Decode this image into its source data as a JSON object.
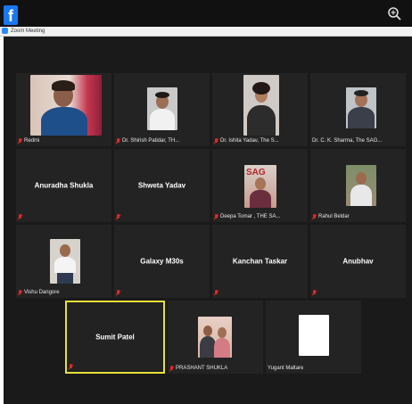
{
  "app": {
    "window_title": "Zoom Meeting"
  },
  "colors": {
    "stage_bg": "#1a1a1a",
    "tile_bg": "#232323",
    "active_border": "#e6df3b",
    "muted_icon": "#e02828",
    "facebook_blue": "#1877f2"
  },
  "icons": {
    "facebook": "facebook-icon",
    "zoom": "zoom-in-icon",
    "muted": "muted-mic-icon"
  },
  "participants": {
    "p1": {
      "name": "Redmi",
      "muted": true
    },
    "p2": {
      "name": "Dr. Shirish Patidar, TH...",
      "muted": true
    },
    "p3": {
      "name": "Dr. Ishita Yadav, The S...",
      "muted": true
    },
    "p4": {
      "name": "Dr. C. K. Sharma, The SAG...",
      "muted": false
    },
    "p5": {
      "name": "Anuradha Shukla",
      "muted": true
    },
    "p6": {
      "name": "Shweta  Yadav",
      "muted": true
    },
    "p7": {
      "name": "Deepa Tomar , THE SA...",
      "muted": true
    },
    "p8": {
      "name": "Rahul Beldar",
      "muted": true
    },
    "p9": {
      "name": "Vishu Dangore",
      "muted": true
    },
    "p10": {
      "name": "Galaxy M30s",
      "muted": true
    },
    "p11": {
      "name": "Kanchan Taskar",
      "muted": true
    },
    "p12": {
      "name": "Anubhav",
      "muted": true
    },
    "p13": {
      "name": "Sumit Patel",
      "muted": true,
      "active_speaker": true
    },
    "p14": {
      "name": "PRASHANT SHUKLA",
      "muted": true
    },
    "p15": {
      "name": "Yugant Maltare",
      "muted": false
    }
  }
}
